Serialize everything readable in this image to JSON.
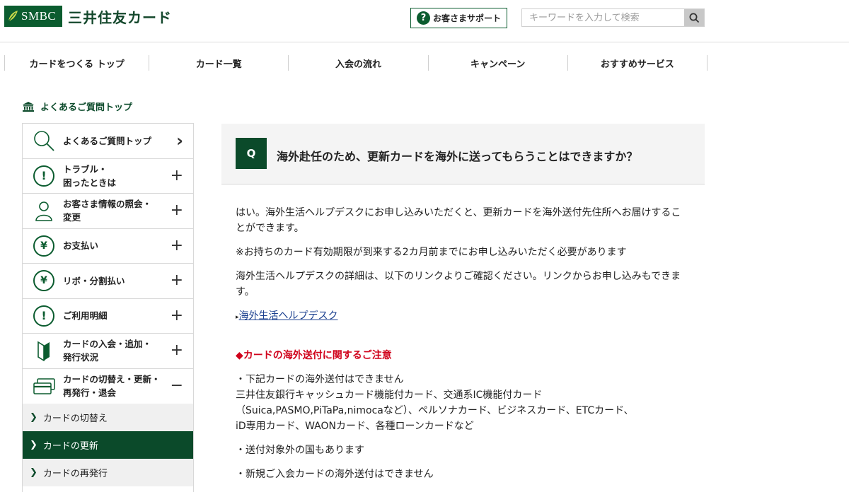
{
  "header": {
    "brand_box": "SMBC",
    "brand_name": "三井住友カード",
    "support_label": "お客さまサポート",
    "search_placeholder": "キーワードを入力して検索"
  },
  "gnav": [
    {
      "label": "カードをつくる トップ"
    },
    {
      "label": "カード一覧"
    },
    {
      "label": "入会の流れ"
    },
    {
      "label": "キャンペーン"
    },
    {
      "label": "おすすめサービス"
    }
  ],
  "breadcrumb": {
    "label": "よくあるご質問トップ"
  },
  "sidebar": {
    "items": [
      {
        "label": "よくあるご質問トップ",
        "icon": "search-icon",
        "action": "›"
      },
      {
        "label": "トラブル・\n困ったときは",
        "icon": "exclamation-icon",
        "action": "+"
      },
      {
        "label": "お客さま情報の照会・\n変更",
        "icon": "person-icon",
        "action": "+"
      },
      {
        "label": "お支払い",
        "icon": "yen-icon",
        "action": "+"
      },
      {
        "label": "リボ・分割払い",
        "icon": "yen-icon",
        "action": "+"
      },
      {
        "label": "ご利用明細",
        "icon": "exclamation-icon",
        "action": "+"
      },
      {
        "label": "カードの入会・追加・\n発行状況",
        "icon": "beginner-mark-icon",
        "action": "+"
      },
      {
        "label": "カードの切替え・更新・\n再発行・退会",
        "icon": "cards-icon",
        "action": "−"
      }
    ],
    "sub_items": [
      {
        "label": "カードの切替え",
        "active": false
      },
      {
        "label": "カードの更新",
        "active": true
      },
      {
        "label": "カードの再発行",
        "active": false
      }
    ]
  },
  "question": {
    "badge": "Q",
    "text": "海外赴任のため、更新カードを海外に送ってもらうことはできますか？"
  },
  "answer": {
    "p1": "はい。海外生活ヘルプデスクにお申し込みいただくと、更新カードを海外送付先住所へお届けすることができます。",
    "p2": "※お持ちのカード有効期限が到来する2カ月前までにお申し込みいただく必要があります",
    "p3": "海外生活ヘルプデスクの詳細は、以下のリンクよりご確認ください。リンクからお申し込みもできます。",
    "link_bullet": "▸",
    "link_text": "海外生活ヘルプデスク",
    "caution_title": "◆カードの海外送付に関するご注意",
    "caution_lines": [
      "・下記カードの海外送付はできません",
      "三井住友銀行キャッシュカード機能付カード、交通系IC機能付カード",
      "（Suica,PASMO,PiTaPa,nimocaなど）、ペルソナカード、ビジネスカード、ETCカード、",
      "iD専用カード、WAONカード、各種ローンカードなど"
    ],
    "p6": "・送付対象外の国もあります",
    "p7": "・新規ご入会カードの海外送付はできません"
  },
  "colors": {
    "brand_green": "#0b5c2f",
    "dark_green": "#0b4a2a",
    "caution_red": "#d0021b",
    "link_blue": "#1a3f8f"
  }
}
